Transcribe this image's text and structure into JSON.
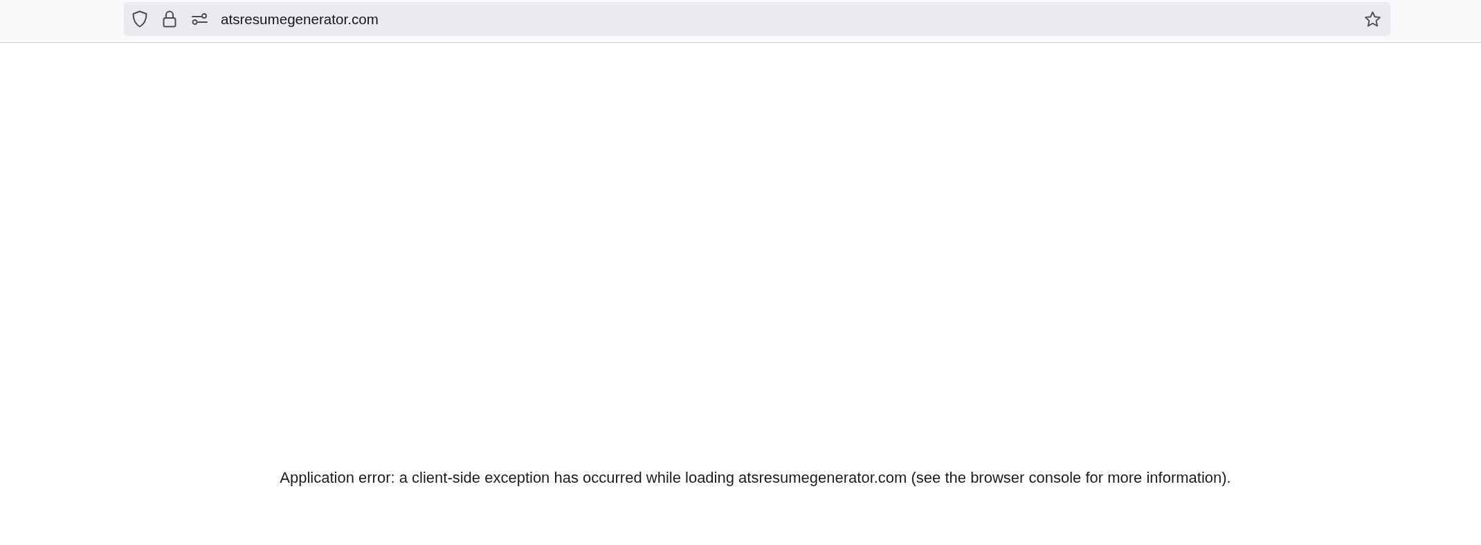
{
  "address_bar": {
    "url": "atsresumegenerator.com"
  },
  "error_message": "Application error: a client-side exception has occurred while loading atsresumegenerator.com (see the browser console for more information)."
}
